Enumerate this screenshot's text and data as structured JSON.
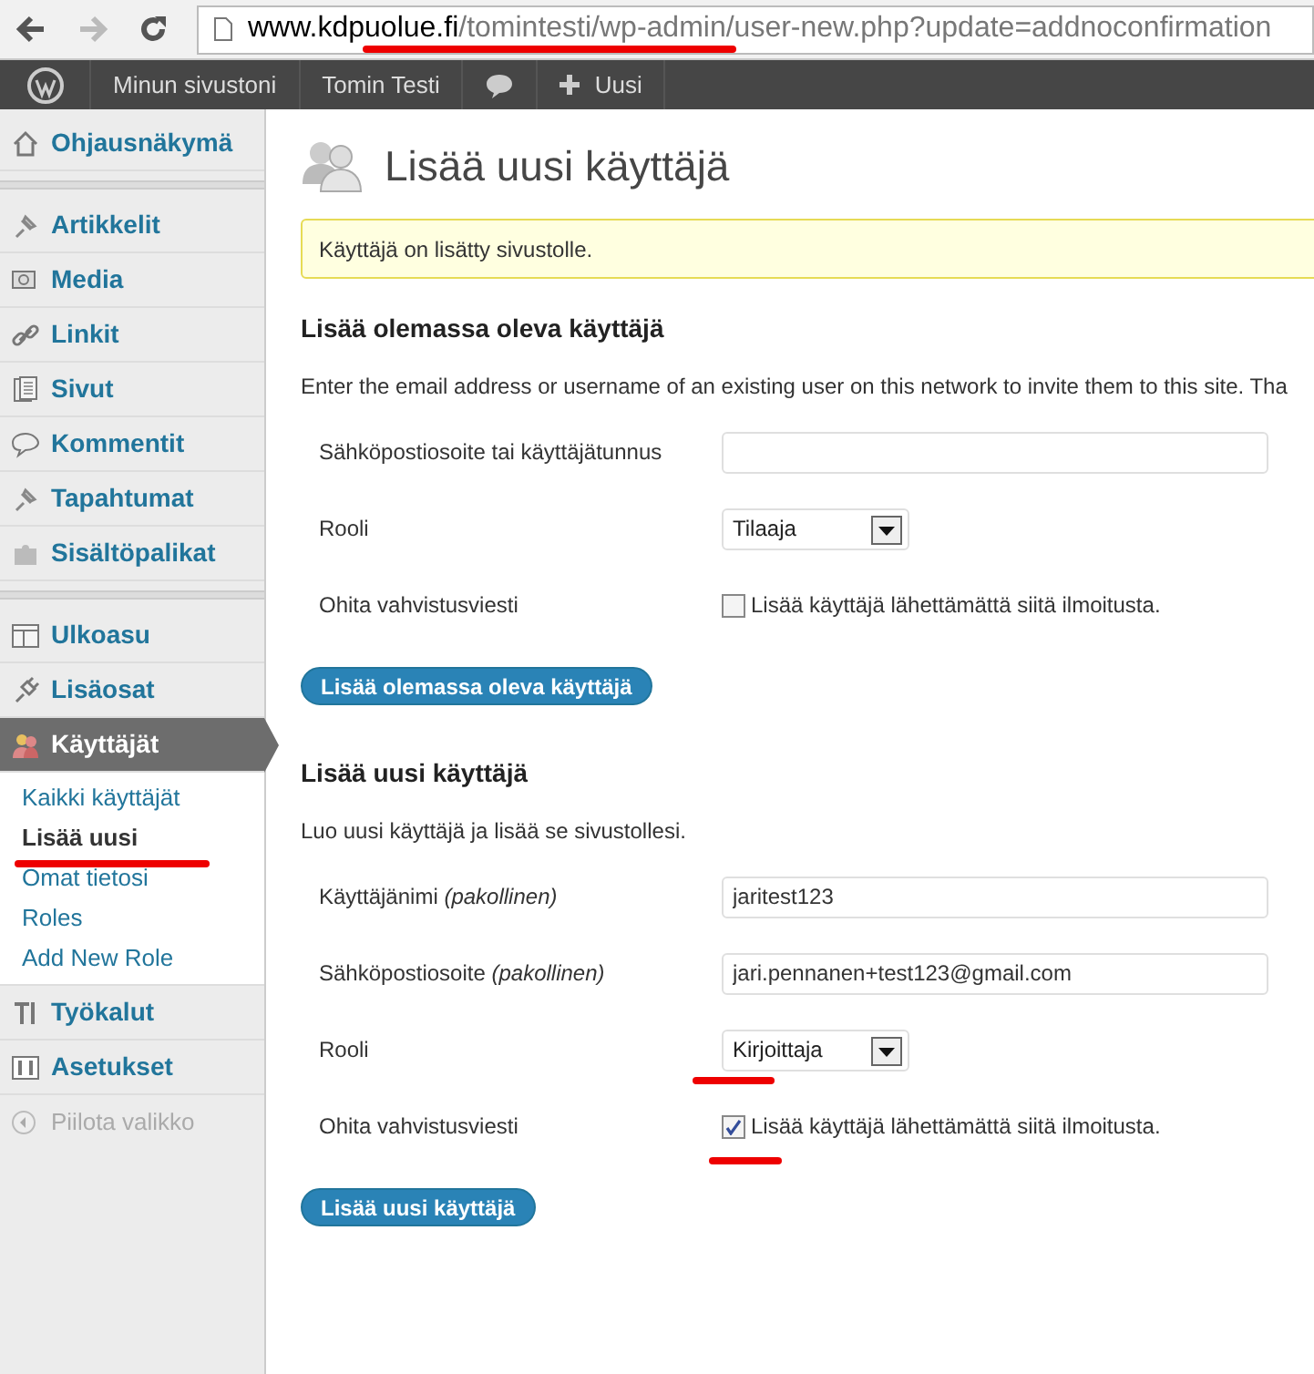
{
  "browser": {
    "url_host": "www.kdpuolue.fi",
    "url_path": "/tomintesti/wp-admin/user-new.php?update=addnoconfirmation",
    "url_underlined": true
  },
  "admin_bar": {
    "items": [
      "Minun sivustoni",
      "Tomin Testi",
      "Uusi"
    ]
  },
  "sidebar": {
    "items": [
      {
        "kind": "item",
        "label": "Ohjausnäkymä",
        "selected": false
      },
      {
        "kind": "separator"
      },
      {
        "kind": "item",
        "label": "Artikkelit",
        "selected": false
      },
      {
        "kind": "item",
        "label": "Media",
        "selected": false
      },
      {
        "kind": "item",
        "label": "Linkit",
        "selected": false
      },
      {
        "kind": "item",
        "label": "Sivut",
        "selected": false
      },
      {
        "kind": "item",
        "label": "Kommentit",
        "selected": false
      },
      {
        "kind": "item",
        "label": "Tapahtumat",
        "selected": false
      },
      {
        "kind": "item",
        "label": "Sisältöpalikat",
        "selected": false
      },
      {
        "kind": "separator"
      },
      {
        "kind": "item",
        "label": "Ulkoasu",
        "selected": false
      },
      {
        "kind": "item",
        "label": "Lisäosat",
        "selected": false
      },
      {
        "kind": "item",
        "label": "Käyttäjät",
        "selected": true,
        "children": [
          {
            "label": "Kaikki käyttäjät",
            "selected": false
          },
          {
            "label": "Lisää uusi",
            "selected": true,
            "underlined": true
          },
          {
            "label": "Omat tietosi",
            "selected": false
          },
          {
            "label": "Roles",
            "selected": false
          },
          {
            "label": "Add New Role",
            "selected": false
          }
        ]
      },
      {
        "kind": "item",
        "label": "Työkalut",
        "selected": false
      },
      {
        "kind": "item",
        "label": "Asetukset",
        "selected": false
      },
      {
        "kind": "collapse",
        "label": "Piilota valikko"
      }
    ]
  },
  "page_title": "Lisää uusi käyttäjä",
  "notice": "Käyttäjä on lisätty sivustolle.",
  "sections": [
    {
      "heading": "Lisää olemassa oleva käyttäjä",
      "description": "Enter the email address or username of an existing user on this network to invite them to this site. Tha",
      "fields": [
        {
          "kind": "text",
          "label": "Sähköpostiosoite tai käyttäjätunnus"
        },
        {
          "kind": "select",
          "label": "Rooli",
          "value": "Tilaaja"
        },
        {
          "kind": "checkbox",
          "label": "Ohita vahvistusviesti",
          "option": "Lisää käyttäjä lähettämättä siitä ilmoitusta.",
          "checked": false
        }
      ],
      "button": "Lisää olemassa oleva käyttäjä"
    },
    {
      "heading": "Lisää uusi käyttäjä",
      "description": "Luo uusi käyttäjä ja lisää se sivustollesi.",
      "fields": [
        {
          "kind": "text",
          "label": "Käyttäjänimi *(pakollinen)*",
          "value": "jaritest123"
        },
        {
          "kind": "text",
          "label": "Sähköpostiosoite *(pakollinen)*",
          "value": "jari.pennanen+test123@gmail.com"
        },
        {
          "kind": "select",
          "label": "Rooli",
          "value": "Kirjoittaja",
          "underlined": true
        },
        {
          "kind": "checkbox",
          "label": "Ohita vahvistusviesti",
          "option": "Lisää käyttäjä lähettämättä siitä ilmoitusta.",
          "checked": true,
          "underlined": true
        }
      ],
      "button": "Lisää uusi käyttäjä"
    }
  ]
}
